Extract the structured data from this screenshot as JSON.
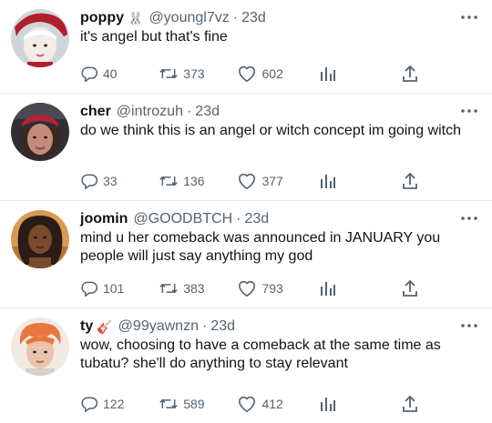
{
  "tweets": [
    {
      "name": "poppy",
      "emoji": "🐰",
      "handle": "@youngl7vz",
      "time": "23d",
      "text": "it's angel but that's fine",
      "replies": "40",
      "retweets": "373",
      "likes": "602",
      "avatar_colors": [
        "#c9d1d6",
        "#f4ece6",
        "#b11f2c"
      ]
    },
    {
      "name": "cher",
      "handle": "@introzuh",
      "time": "23d",
      "text": "do we think this is an angel or witch concept im going witch",
      "replies": "33",
      "retweets": "136",
      "likes": "377",
      "avatar_colors": [
        "#2f2f36",
        "#c48c79",
        "#b5213a"
      ]
    },
    {
      "name": "joomin",
      "handle": "@GOODBTCH",
      "time": "23d",
      "text": "mind u her comeback was announced in JANUARY you people will just say anything my god",
      "replies": "101",
      "retweets": "383",
      "likes": "793",
      "avatar_colors": [
        "#d99a53",
        "#7a4a2f",
        "#2a1c16"
      ]
    },
    {
      "name": "ty",
      "emoji": "🎸",
      "handle": "@99yawnzn",
      "time": "23d",
      "text": "wow, choosing to have a comeback at the same time as tubatu? she'll do anything to stay relevant",
      "replies": "122",
      "retweets": "589",
      "likes": "412",
      "avatar_colors": [
        "#f2e9e4",
        "#e8773f",
        "#e9c3ad"
      ]
    }
  ],
  "colors": {
    "text": "#0f1419",
    "muted": "#536471",
    "divider": "#e6ecf0",
    "icon": "#536471"
  }
}
